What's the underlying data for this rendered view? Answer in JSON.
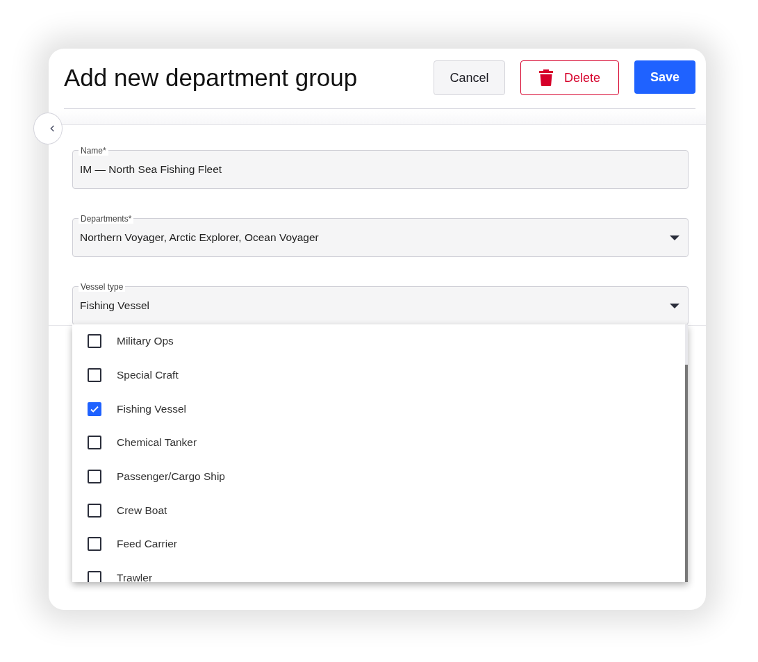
{
  "dialog": {
    "title": "Add new department group"
  },
  "buttons": [
    {
      "kind": "cancel",
      "label": "Cancel"
    },
    {
      "kind": "delete",
      "label": "Delete"
    },
    {
      "kind": "save",
      "label": "Save"
    }
  ],
  "fields": [
    {
      "kind": "text",
      "label": "Name*",
      "value": "IM — North Sea Fishing Fleet"
    },
    {
      "kind": "select",
      "label": "Departments*",
      "value": "Northern Voyager, Arctic Explorer, Ocean Voyager"
    },
    {
      "kind": "select",
      "label": "Vessel type",
      "value": "Fishing Vessel"
    }
  ],
  "dropdown": {
    "options": [
      {
        "label": "Military Ops",
        "checked": false
      },
      {
        "label": "Special Craft",
        "checked": false
      },
      {
        "label": "Fishing Vessel",
        "checked": true
      },
      {
        "label": "Chemical Tanker",
        "checked": false
      },
      {
        "label": "Passenger/Cargo Ship",
        "checked": false
      },
      {
        "label": "Crew Boat",
        "checked": false
      },
      {
        "label": "Feed Carrier",
        "checked": false
      },
      {
        "label": "Trawler",
        "checked": false
      }
    ]
  }
}
